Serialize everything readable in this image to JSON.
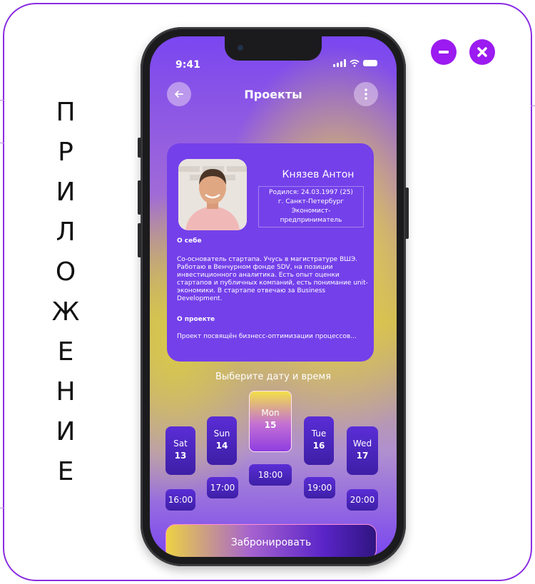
{
  "side_title_letters": [
    "П",
    "Р",
    "И",
    "Л",
    "О",
    "Ж",
    "Е",
    "Н",
    "И",
    "Е"
  ],
  "window_controls": {
    "minimize_icon": "minus-circle-icon",
    "close_icon": "x-circle-icon",
    "accent": "#9b1bf0"
  },
  "status_bar": {
    "time": "9:41"
  },
  "header": {
    "title": "Проекты",
    "back_icon": "arrow-left-icon",
    "menu_icon": "kebab-menu-icon"
  },
  "profile": {
    "name": "Князев Антон",
    "info_lines": [
      "Родился: 24.03.1997 (25)",
      "г. Санкт-Петербург",
      "Экономист-",
      "предприниматель"
    ],
    "about_heading": "О себе",
    "about_text": "Со-основатель стартапа. Учусь в магистратуре ВШЭ. Работаю в Венчурном фонде SDV, на позиции инвестиционного аналитика. Есть опыт оценки стартапов и публичных компаний, есть понимание unit-экономики. В стартапе отвечаю за Business Development.",
    "project_heading": "О проекте",
    "project_text": "Проект посвящён бизнесс-оптимизации процессов..."
  },
  "scheduler": {
    "prompt": "Выберите дату и время",
    "days": [
      {
        "name": "Sat",
        "num": "13"
      },
      {
        "name": "Sun",
        "num": "14"
      },
      {
        "name": "Mon",
        "num": "15",
        "selected": true
      },
      {
        "name": "Tue",
        "num": "16"
      },
      {
        "name": "Wed",
        "num": "17"
      }
    ],
    "times": [
      "16:00",
      "17:00",
      "18:00",
      "19:00",
      "20:00"
    ]
  },
  "book_button": "Забронировать"
}
